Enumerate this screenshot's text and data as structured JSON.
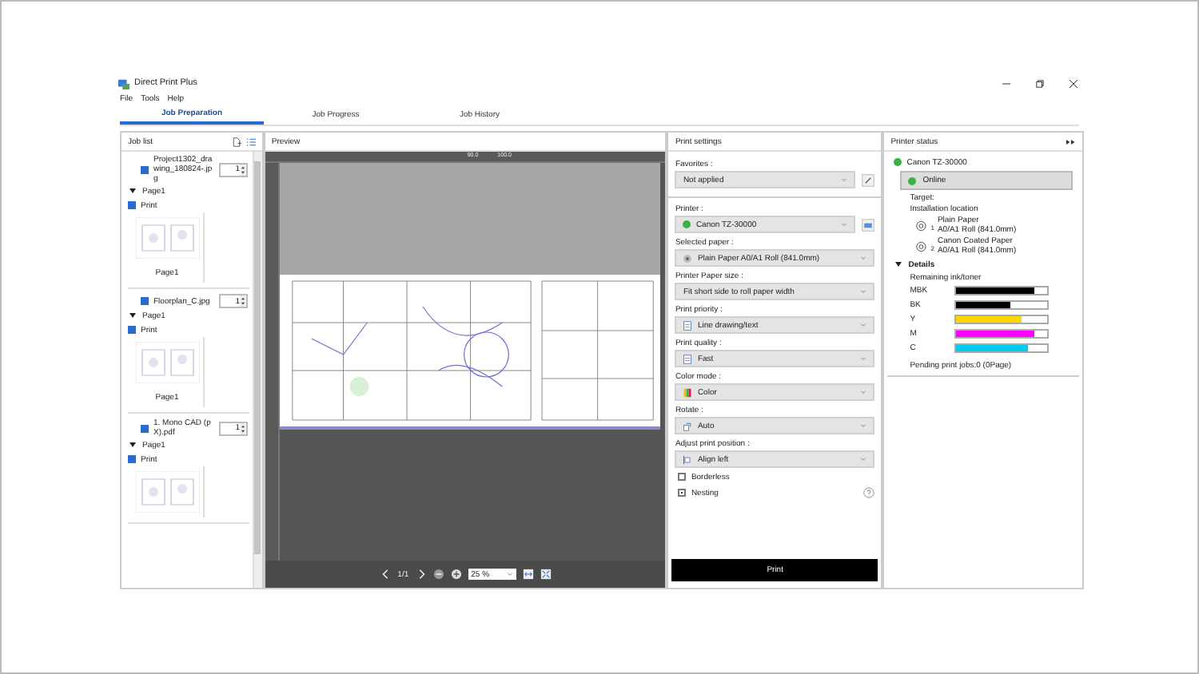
{
  "window": {
    "title": "Direct Print Plus"
  },
  "menu": [
    "File",
    "Tools",
    "Help"
  ],
  "tabs": [
    {
      "label": "Job Preparation",
      "selected": true
    },
    {
      "label": "Job Progress",
      "selected": false
    },
    {
      "label": "Job History",
      "selected": false
    }
  ],
  "job_list": {
    "title": "Job list",
    "jobs": [
      {
        "name": "Project1302_drawing_180824-.jpg",
        "checked": true,
        "copies": "1",
        "page": "Page1",
        "expanded": true,
        "print_label": "Print",
        "print_checked": true,
        "caption": "Page1"
      },
      {
        "name": "Floorplan_C.jpg",
        "checked": true,
        "copies": "1",
        "page": "Page1",
        "expanded": true,
        "print_label": "Print",
        "print_checked": true,
        "caption": "Page1"
      },
      {
        "name": "1. Mono CAD (pX).pdf",
        "checked": true,
        "copies": "1",
        "page": "Page1",
        "expanded": true,
        "print_label": "Print",
        "print_checked": true
      }
    ]
  },
  "preview": {
    "title": "Preview",
    "ruler_labels": [
      "90.0",
      "100.0"
    ],
    "page": "1/1",
    "zoom": "25 %"
  },
  "print_settings": {
    "title": "Print settings",
    "fields": [
      {
        "label": "Favorites :",
        "value": "Not applied"
      },
      {
        "label": "Printer :",
        "value": "Canon TZ-30000"
      },
      {
        "label": "Selected paper :",
        "value": "Plain Paper A0/A1 Roll (841.0mm)"
      },
      {
        "label": "Printer Paper size :",
        "value": "Fit short side to roll paper width"
      },
      {
        "label": "Print priority :",
        "value": "Line drawing/text"
      },
      {
        "label": "Print quality :",
        "value": "Fast"
      },
      {
        "label": "Color mode :",
        "value": "Color"
      },
      {
        "label": "Rotate :",
        "value": "Auto"
      },
      {
        "label": "Adjust print position :",
        "value": "Align left"
      }
    ],
    "options": [
      {
        "label": "Borderless",
        "checked": false
      },
      {
        "label": "Nesting",
        "checked": true
      }
    ],
    "print_button": "Print"
  },
  "printer_status": {
    "title": "Printer status",
    "printer": "Canon TZ-30000",
    "status": "Online",
    "target_label": "Target:",
    "target": "Installation location",
    "rolls": [
      {
        "number": "1",
        "paper": "Plain Paper",
        "size": "A0/A1 Roll (841.0mm)"
      },
      {
        "number": "2",
        "paper": "Canon Coated Paper",
        "size": "A0/A1 Roll (841.0mm)"
      }
    ],
    "details": {
      "title": "Details",
      "expanded": true,
      "ink_title": "Remaining ink/toner",
      "inks": [
        {
          "name": "MBK",
          "color": "#000000",
          "level": 0.85
        },
        {
          "name": "BK",
          "color": "#000000",
          "level": 0.6
        },
        {
          "name": "Y",
          "color": "#ffd700",
          "level": 0.72
        },
        {
          "name": "M",
          "color": "#ff00ff",
          "level": 0.85
        },
        {
          "name": "C",
          "color": "#00c8f0",
          "level": 0.78
        }
      ],
      "pending": "Pending print jobs:0 (0Page)"
    }
  }
}
